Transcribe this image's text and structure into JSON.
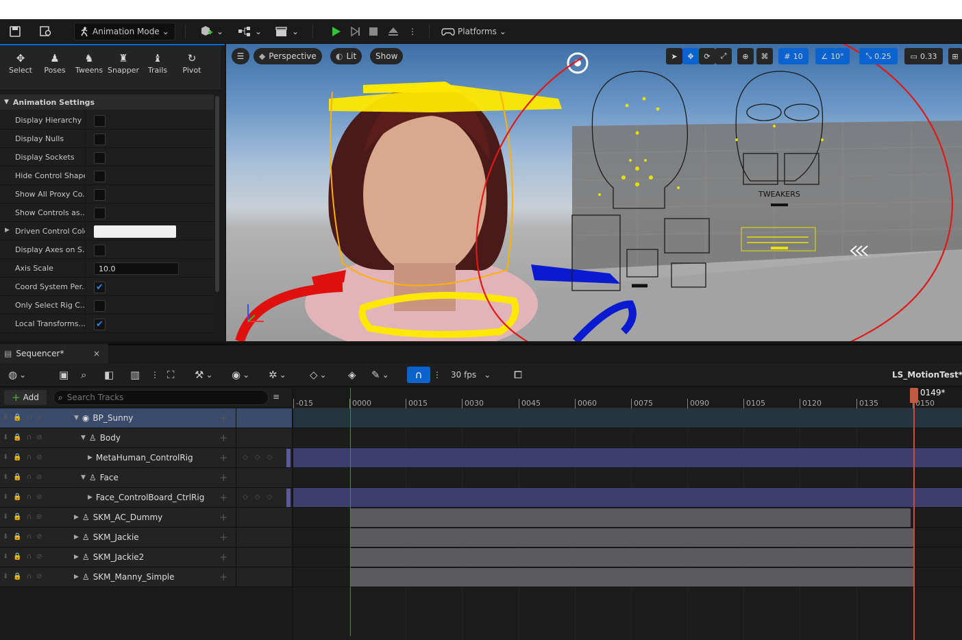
{
  "toolbar": {
    "mode": "Animation Mode",
    "platforms": "Platforms"
  },
  "modes": [
    {
      "label": "Select",
      "icon": "select-icon"
    },
    {
      "label": "Poses",
      "icon": "poses-icon"
    },
    {
      "label": "Tweens",
      "icon": "tweens-icon"
    },
    {
      "label": "Snapper",
      "icon": "snapper-icon"
    },
    {
      "label": "Trails",
      "icon": "trails-icon"
    },
    {
      "label": "Pivot",
      "icon": "pivot-icon"
    }
  ],
  "animation_settings": {
    "title": "Animation Settings",
    "rows": [
      {
        "label": "Display Hierarchy",
        "checked": false
      },
      {
        "label": "Display Nulls",
        "checked": false
      },
      {
        "label": "Display Sockets",
        "checked": false
      },
      {
        "label": "Hide Control Shapes",
        "checked": false
      },
      {
        "label": "Show All Proxy Co...",
        "checked": false
      },
      {
        "label": "Show Controls as...",
        "checked": false
      },
      {
        "label": "Driven Control Color",
        "color": "#f0f0f0"
      },
      {
        "label": "Display Axes on S...",
        "checked": false
      },
      {
        "label": "Axis Scale",
        "value": "10.0"
      },
      {
        "label": "Coord System Per...",
        "checked": true
      },
      {
        "label": "Only Select Rig C...",
        "checked": false
      },
      {
        "label": "Local Transforms...",
        "checked": true
      }
    ]
  },
  "viewport": {
    "perspective": "Perspective",
    "lit": "Lit",
    "show": "Show",
    "grid_value": "10",
    "angle_value": "10°",
    "scale_value": "0.25",
    "camera_value": "0.33",
    "board_label": "TWEAKERS"
  },
  "sequencer": {
    "tab": "Sequencer*",
    "fps": "30 fps",
    "sequence_name": "LS_MotionTest*",
    "add_label": "Add",
    "search_placeholder": "Search Tracks",
    "current_frame": "0149*",
    "ticks": [
      "-015",
      "0000",
      "0015",
      "0030",
      "0045",
      "0060",
      "0075",
      "0090",
      "0105",
      "0120",
      "0135",
      "0150"
    ],
    "tracks": [
      {
        "name": "BP_Sunny",
        "indent": 0,
        "selected": true
      },
      {
        "name": "Body",
        "indent": 1
      },
      {
        "name": "MetaHuman_ControlRig",
        "indent": 2
      },
      {
        "name": "Face",
        "indent": 1
      },
      {
        "name": "Face_ControlBoard_CtrlRig",
        "indent": 2
      },
      {
        "name": "SKM_AC_Dummy",
        "indent": 0
      },
      {
        "name": "SKM_Jackie",
        "indent": 0
      },
      {
        "name": "SKM_Jackie2",
        "indent": 0
      },
      {
        "name": "SKM_Manny_Simple",
        "indent": 0
      }
    ]
  },
  "colors": {
    "accent": "#0070e0",
    "playhead": "#c05040",
    "start": "#1fa01f"
  }
}
